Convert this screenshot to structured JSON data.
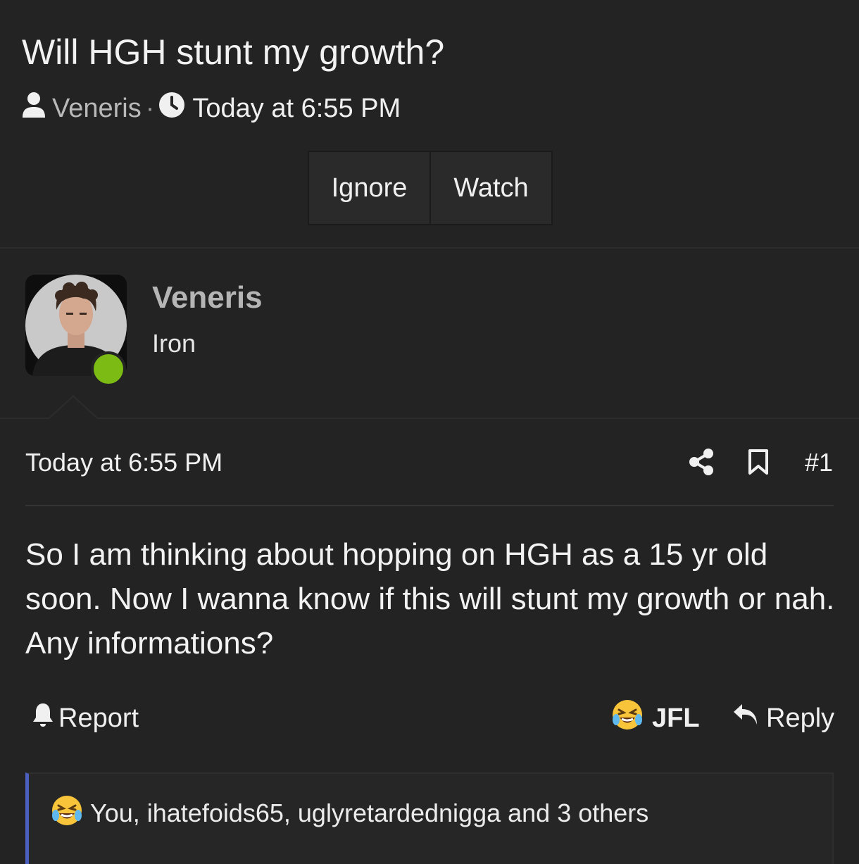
{
  "thread": {
    "title": "Will HGH stunt my growth?",
    "author": "Veneris",
    "separator": "·",
    "time": "Today at 6:55 PM"
  },
  "actions": {
    "ignore": "Ignore",
    "watch": "Watch"
  },
  "post": {
    "author_name": "Veneris",
    "author_title": "Iron",
    "date": "Today at 6:55 PM",
    "number": "#1",
    "body": "So I am thinking about hopping on HGH as a 15 yr old soon. Now I wanna know if this will stunt my growth or nah. Any informations?",
    "report_label": "Report",
    "reaction_label": "JFL",
    "reply_label": "Reply",
    "reactions_summary": "You, ihatefoids65, uglyretardednigga and 3 others"
  },
  "colors": {
    "background": "#232323",
    "online_indicator": "#7cbb14",
    "reactions_accent": "#4b5fbf"
  },
  "icons": {
    "author": "user-icon",
    "time": "clock-icon",
    "share": "share-icon",
    "bookmark": "bookmark-icon",
    "report": "bell-icon",
    "reaction": "laughing-emoji-icon",
    "reply": "reply-arrow-icon"
  }
}
